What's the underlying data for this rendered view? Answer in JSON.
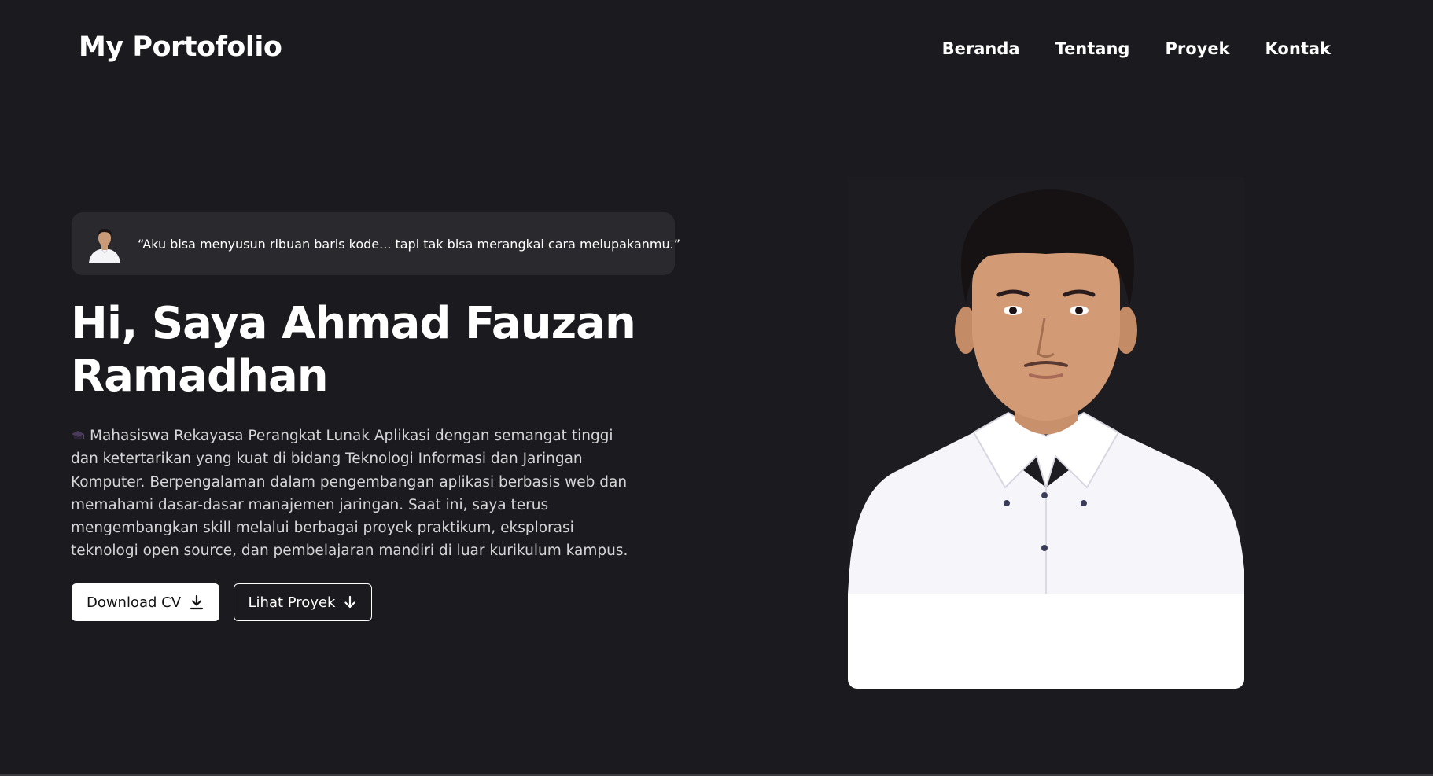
{
  "header": {
    "brand": "My Portofolio",
    "nav": [
      {
        "label": "Beranda"
      },
      {
        "label": "Tentang"
      },
      {
        "label": "Proyek"
      },
      {
        "label": "Kontak"
      }
    ]
  },
  "hero": {
    "quote": "“Aku bisa menyusun ribuan baris kode... tapi tak bisa merangkai cara melupakanmu.”",
    "title_line1": "Hi, Saya Ahmad Fauzan",
    "title_line2": "Ramadhan",
    "description": "Mahasiswa Rekayasa Perangkat Lunak Aplikasi dengan semangat tinggi dan ketertarikan yang kuat di bidang Teknologi Informasi dan Jaringan Komputer. Berpengalaman dalam pengembangan aplikasi berbasis web dan memahami dasar-dasar manajemen jaringan. Saat ini, saya terus mengembangkan skill melalui berbagai proyek praktikum, eksplorasi teknologi open source, dan pembelajaran mandiri di luar kurikulum kampus.",
    "buttons": {
      "download_cv": "Download CV",
      "view_projects": "Lihat Proyek"
    }
  },
  "colors": {
    "background": "#1b1a1e",
    "card": "#2a292e",
    "text": "#ffffff",
    "muted_text": "#d6d6d8"
  },
  "icons": {
    "description_prefix": "graduation-cap-icon",
    "download_button": "download-icon",
    "projects_button": "arrow-down-icon"
  }
}
